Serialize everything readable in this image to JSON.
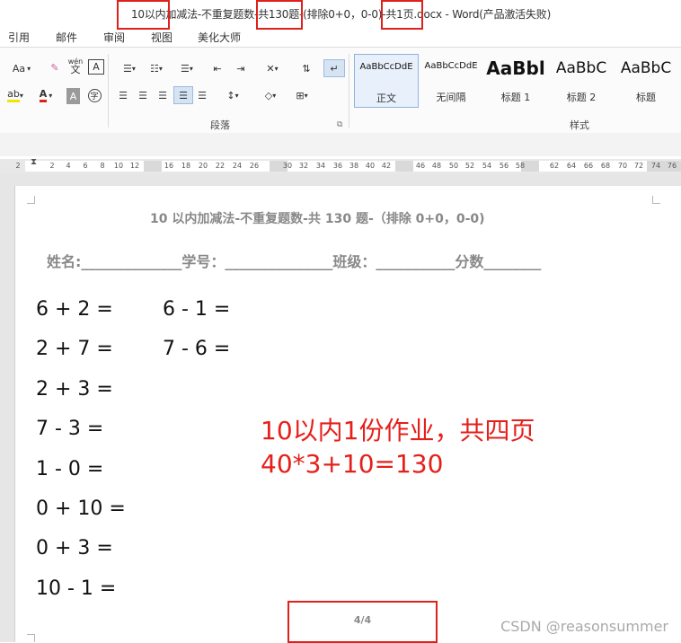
{
  "window": {
    "title": "10以内加减法-不重复题数-共130题-(排除0+0，0-0)-共1页.docx - Word(产品激活失败)"
  },
  "ribbon_tabs": [
    "引用",
    "邮件",
    "审阅",
    "视图",
    "美化大师"
  ],
  "ribbon": {
    "font_group": {
      "font_size_label": "Aa",
      "phonetic_label": "wén",
      "phonetic_char": "文",
      "boxed_char": "A",
      "enclosed_char": "字"
    },
    "paragraph_group": {
      "label": "段落"
    },
    "styles_group": {
      "label": "样式",
      "items": [
        {
          "sample": "AaBbCcDdE",
          "name": "正文",
          "selected": true
        },
        {
          "sample": "AaBbCcDdE",
          "name": "无间隔"
        },
        {
          "sample": "AaBbl",
          "name": "标题 1"
        },
        {
          "sample": "AaBbC",
          "name": "标题 2"
        },
        {
          "sample": "AaBbC",
          "name": "标题"
        }
      ]
    }
  },
  "ruler": {
    "ticks": [
      "2",
      "2",
      "4",
      "6",
      "8",
      "10",
      "12",
      "16",
      "18",
      "20",
      "22",
      "24",
      "26",
      "30",
      "32",
      "34",
      "36",
      "38",
      "40",
      "42",
      "46",
      "48",
      "50",
      "52",
      "54",
      "56",
      "58",
      "62",
      "64",
      "66",
      "68",
      "70",
      "72",
      "74",
      "76"
    ]
  },
  "document": {
    "title": "10 以内加减法-不重复题数-共 130 题-（排除 0+0，0-0)",
    "info_line": "姓名:______________学号：_______________班级：___________分数________",
    "problems_col1": [
      "6 + 2 =",
      "2 + 7 =",
      "2 + 3 =",
      "7 - 3 =",
      "1 - 0 =",
      "0 + 10 =",
      "0 + 3 =",
      "10 - 1 ="
    ],
    "problems_col2": [
      "6 - 1 =",
      "7 - 6 ="
    ],
    "page_number": "4/4"
  },
  "annotation": {
    "line1": "10以内1份作业，共四页",
    "line2": "40*3+10=130",
    "color": "#e5201b"
  },
  "watermark": "CSDN @reasonsummer"
}
